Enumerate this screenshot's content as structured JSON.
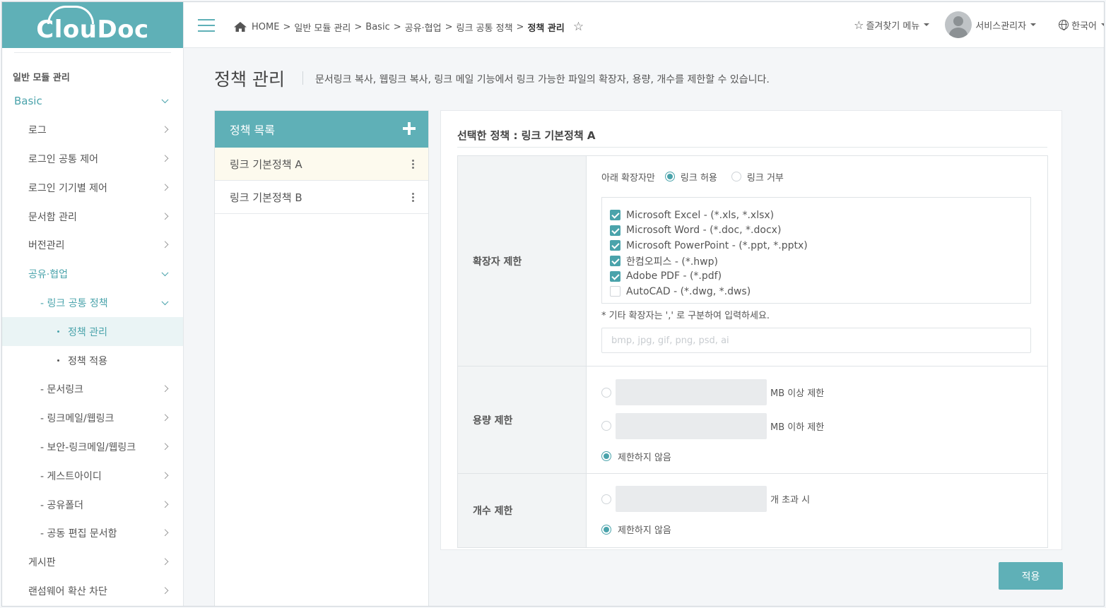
{
  "app": {
    "logo": "ClouDoc"
  },
  "sidebar": {
    "section_title": "일반 모듈 관리",
    "items": [
      {
        "label": "Basic",
        "level": 0,
        "expanded": true
      },
      {
        "label": "로그",
        "level": 1
      },
      {
        "label": "로그인 공통 제어",
        "level": 1
      },
      {
        "label": "로그인 기기별 제어",
        "level": 1
      },
      {
        "label": "문서함 관리",
        "level": 1
      },
      {
        "label": "버전관리",
        "level": 1
      },
      {
        "label": "공유·협업",
        "level": 1,
        "expanded": true
      },
      {
        "label": "- 링크 공통 정책",
        "level": 2,
        "expanded": true
      },
      {
        "label": "정책 관리",
        "level": 3,
        "active": true
      },
      {
        "label": "정책 적용",
        "level": 3
      },
      {
        "label": "- 문서링크",
        "level": 2
      },
      {
        "label": "- 링크메일/웹링크",
        "level": 2
      },
      {
        "label": "- 보안-링크메일/웹링크",
        "level": 2
      },
      {
        "label": "- 게스트아이디",
        "level": 2
      },
      {
        "label": "- 공유폴더",
        "level": 2
      },
      {
        "label": "- 공동 편집 문서함",
        "level": 2
      },
      {
        "label": "게시판",
        "level": 1
      },
      {
        "label": "랜섬웨어 확산 차단",
        "level": 1
      }
    ]
  },
  "topbar": {
    "breadcrumb": [
      "HOME",
      "일반 모듈 관리",
      "Basic",
      "공유·협업",
      "링크 공통 정책",
      "정책 관리"
    ],
    "breadcrumb_sep": ">",
    "favorites_label": "즐겨찾기 메뉴",
    "user_name": "서비스관리자",
    "language": "한국어"
  },
  "page": {
    "title": "정책 관리",
    "description": "문서링크 복사, 웹링크 복사, 링크 메일 기능에서 링크 가능한 파일의 확장자, 용량, 개수를 제한할 수 있습니다."
  },
  "policy_list": {
    "header": "정책 목록",
    "items": [
      {
        "name": "링크 기본정책 A",
        "selected": true
      },
      {
        "name": "링크 기본정책 B",
        "selected": false
      }
    ]
  },
  "detail": {
    "selected_label": "선택한 정책 : 링크 기본정책 A",
    "extension": {
      "label": "확장자 제한",
      "prefix": "아래 확장자만",
      "allow_label": "링크 허용",
      "deny_label": "링크 거부",
      "mode": "allow",
      "options": [
        {
          "label": "Microsoft Excel - (*.xls, *.xlsx)",
          "checked": true
        },
        {
          "label": "Microsoft Word - (*.doc, *.docx)",
          "checked": true
        },
        {
          "label": "Microsoft PowerPoint - (*.ppt, *.pptx)",
          "checked": true
        },
        {
          "label": "한컴오피스 - (*.hwp)",
          "checked": true
        },
        {
          "label": "Adobe PDF - (*.pdf)",
          "checked": true
        },
        {
          "label": "AutoCAD - (*.dwg, *.dws)",
          "checked": false
        }
      ],
      "note": "* 기타 확장자는 ',' 로 구분하여 입력하세요.",
      "other_placeholder": "bmp, jpg, gif, png, psd, ai",
      "other_value": ""
    },
    "size": {
      "label": "용량 제한",
      "min_suffix": "MB 이상 제한",
      "max_suffix": "MB 이하 제한",
      "none_label": "제한하지 않음",
      "mode": "none"
    },
    "count": {
      "label": "개수 제한",
      "over_suffix": "개 초과 시",
      "none_label": "제한하지 않음",
      "mode": "none"
    }
  },
  "apply_label": "적용",
  "colors": {
    "accent": "#5fb0b7",
    "accent_text": "#4aa3ab"
  }
}
